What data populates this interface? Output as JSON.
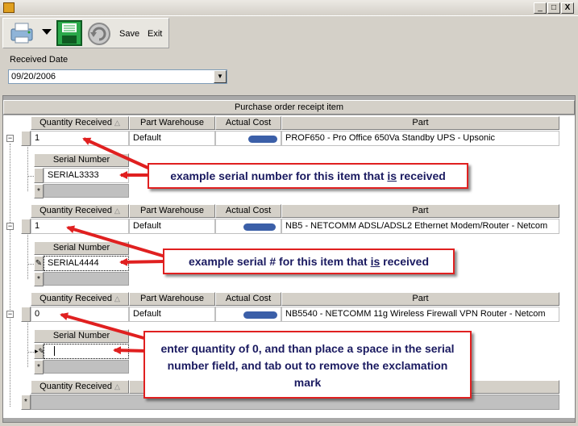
{
  "window": {
    "min_glyph": "_",
    "max_glyph": "□",
    "close_glyph": "X"
  },
  "toolbar": {
    "save_label": "Save",
    "exit_label": "Exit"
  },
  "received_date": {
    "label": "Received Date",
    "value": "09/20/2006"
  },
  "grid": {
    "caption": "Purchase order receipt item",
    "columns": [
      "Quantity Received",
      "Part Warehouse",
      "Actual Cost",
      "Part"
    ],
    "serial_header": "Serial Number",
    "new_row_glyph": "*",
    "expander_glyph": "−",
    "rows": [
      {
        "quantity": "1",
        "warehouse": "Default",
        "part": "PROF650 - Pro Office 650Va Standby UPS - Upsonic",
        "serial": "SERIAL3333"
      },
      {
        "quantity": "1",
        "warehouse": "Default",
        "part": "NB5 - NETCOMM ADSL/ADSL2 Ethernet Modem/Router - Netcom",
        "serial": "SERIAL4444",
        "edit_glyph": "✎"
      },
      {
        "quantity": "0",
        "warehouse": "Default",
        "part": "NB5540 - NETCOMM 11g Wireless Firewall VPN Router - Netcom",
        "serial": "",
        "edit_glyph": "▸✎"
      }
    ]
  },
  "callouts": [
    {
      "pre": "example serial number for this item that ",
      "u": "is",
      "post": " received"
    },
    {
      "pre": "example serial # for this item that ",
      "u": "is",
      "post": " received"
    },
    {
      "text": "enter quantity of 0, and than place a space in the serial number field, and tab out to remove the exclamation mark"
    }
  ],
  "colors": {
    "arrow": "#e02020",
    "callout_text": "#1a1a60",
    "background": "#d4d0c8"
  }
}
